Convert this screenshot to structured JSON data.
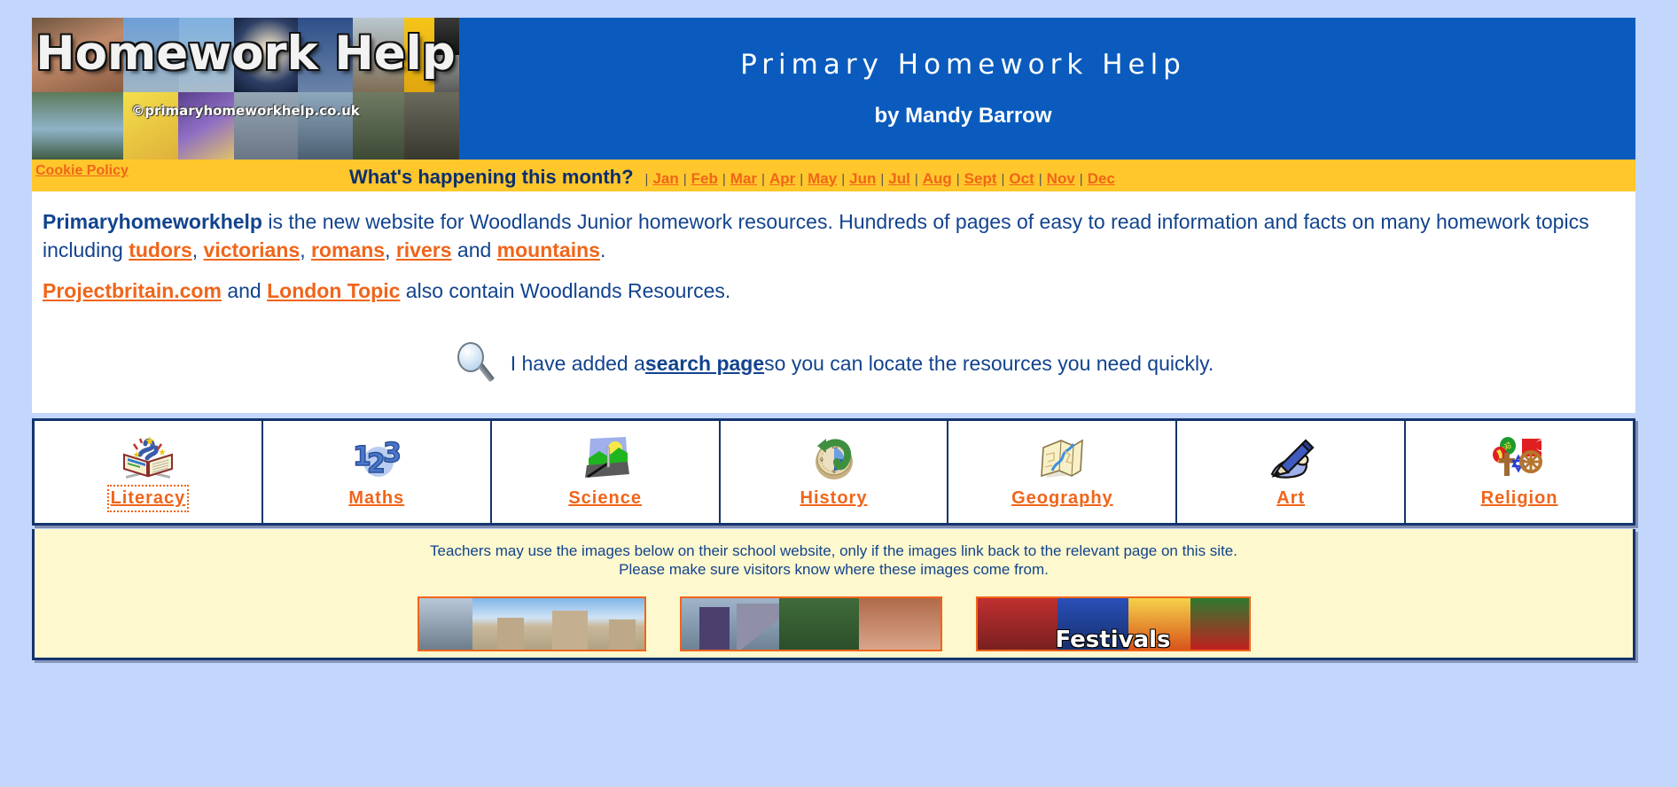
{
  "page": {
    "background_color": "#c3d6fb",
    "content_background": "#ffffff"
  },
  "header": {
    "banner_title": "Homework Help",
    "banner_credit": "©primaryhomeworkhelp.co.uk",
    "site_title": "Primary Homework Help",
    "author": "by Mandy Barrow",
    "header_color": "#0a5bbd"
  },
  "monthbar": {
    "background_color": "#ffc72c",
    "cookie_policy": "Cookie Policy",
    "heading": "What's happening this month?",
    "separator": "|",
    "months": [
      "Jan",
      "Feb",
      "Mar",
      "Apr",
      "May",
      "Jun",
      "Jul",
      "Aug",
      "Sept",
      "Oct",
      "Nov",
      "Dec"
    ]
  },
  "intro": {
    "p1_lead": "Primaryhomeworkhelp",
    "p1_a": " is the new website for Woodlands Junior homework resources. Hundreds of pages of easy to read information and facts on many homework topics including ",
    "p1_links": [
      "tudors",
      "victorians",
      "romans",
      "rivers",
      "mountains"
    ],
    "p1_sep": ", ",
    "p1_and": " and ",
    "p1_end": ".",
    "p2_link1": "Projectbritain.com",
    "p2_mid": " and ",
    "p2_link2": "London Topic",
    "p2_end": " also contain Woodlands Resources.",
    "search_pre": "I have added a ",
    "search_link": "search page",
    "search_post": " so you can locate the resources you need quickly.",
    "link_color": "#f0651a",
    "text_color": "#12438e"
  },
  "subjects": [
    {
      "label": "Literacy",
      "icon": "open-book-icon",
      "focused": true
    },
    {
      "label": "Maths",
      "icon": "numbers-123-icon",
      "focused": false
    },
    {
      "label": "Science",
      "icon": "landscape-sun-icon",
      "focused": false
    },
    {
      "label": "History",
      "icon": "clock-arrow-icon",
      "focused": false
    },
    {
      "label": "Geography",
      "icon": "folded-map-icon",
      "focused": false
    },
    {
      "label": "Art",
      "icon": "pencil-paper-icon",
      "focused": false
    },
    {
      "label": "Religion",
      "icon": "faith-symbols-icon",
      "focused": false
    }
  ],
  "footer": {
    "note_line1": "Teachers may use the images below on their school website, only if the images link back to the relevant page on this site.",
    "note_line2": "Please make sure visitors know where these images come from.",
    "background_color": "#fdf8cd",
    "thumbnails": [
      {
        "name": "castles-thumb",
        "caption": ""
      },
      {
        "name": "ancient-egypt-thumb",
        "caption": ""
      },
      {
        "name": "festivals-thumb",
        "caption": "Festivals"
      }
    ]
  }
}
